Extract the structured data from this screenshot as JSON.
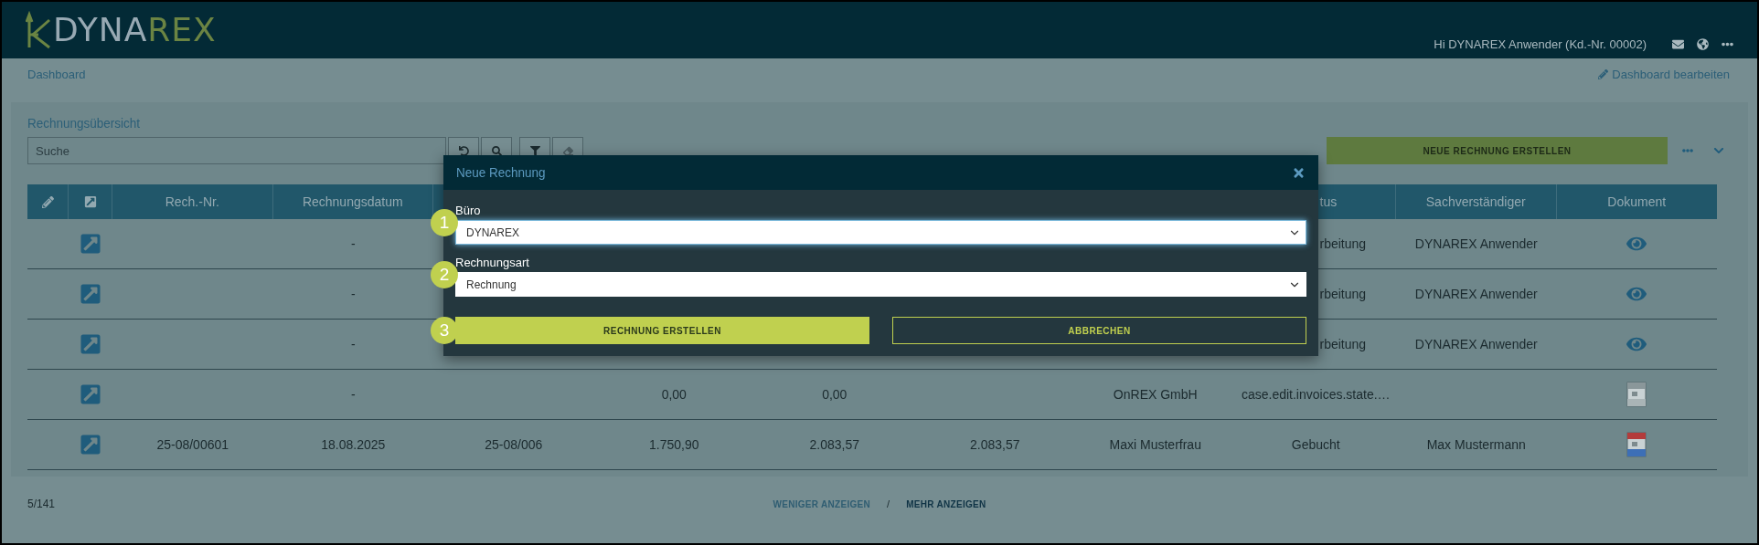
{
  "header": {
    "logo": {
      "part_1": "DYNA",
      "part_2": "REX"
    },
    "greeting": "Hi DYNAREX Anwender (Kd.-Nr. 00002)"
  },
  "breadcrumb": "Dashboard",
  "edit_dashboard_link": "Dashboard bearbeiten",
  "panel": {
    "title": "Rechnungsübersicht",
    "search": {
      "placeholder": "Suche"
    },
    "create_button": "NEUE RECHNUNG ERSTELLEN"
  },
  "table": {
    "columns": [
      {
        "kind": "edit"
      },
      {
        "kind": "link"
      },
      {
        "kind": "text",
        "label": "Rech.-Nr."
      },
      {
        "kind": "text",
        "label": "Rechnungsdatum"
      },
      {
        "kind": "covered"
      },
      {
        "kind": "covered"
      },
      {
        "kind": "covered"
      },
      {
        "kind": "covered"
      },
      {
        "kind": "covered"
      },
      {
        "kind": "partial",
        "label": "tus"
      },
      {
        "kind": "text",
        "label": "Sachverständiger"
      },
      {
        "kind": "text",
        "label": "Dokument"
      }
    ],
    "rows": [
      {
        "cells": [
          {
            "kind": "empty"
          },
          {
            "kind": "link"
          },
          {
            "kind": "empty"
          },
          {
            "kind": "text",
            "text": "-"
          },
          {
            "kind": "covered"
          },
          {
            "kind": "covered"
          },
          {
            "kind": "covered"
          },
          {
            "kind": "covered"
          },
          {
            "kind": "covered"
          },
          {
            "kind": "partial",
            "text": "rbeitung"
          },
          {
            "kind": "text",
            "text": "DYNAREX Anwender"
          },
          {
            "kind": "eye"
          }
        ]
      },
      {
        "cells": [
          {
            "kind": "empty"
          },
          {
            "kind": "link"
          },
          {
            "kind": "empty"
          },
          {
            "kind": "text",
            "text": "-"
          },
          {
            "kind": "covered"
          },
          {
            "kind": "covered"
          },
          {
            "kind": "covered"
          },
          {
            "kind": "covered"
          },
          {
            "kind": "covered"
          },
          {
            "kind": "partial",
            "text": "rbeitung"
          },
          {
            "kind": "text",
            "text": "DYNAREX Anwender"
          },
          {
            "kind": "eye"
          }
        ]
      },
      {
        "cells": [
          {
            "kind": "empty"
          },
          {
            "kind": "link"
          },
          {
            "kind": "empty"
          },
          {
            "kind": "text",
            "text": "-"
          },
          {
            "kind": "covered"
          },
          {
            "kind": "covered"
          },
          {
            "kind": "covered"
          },
          {
            "kind": "covered"
          },
          {
            "kind": "covered"
          },
          {
            "kind": "partial",
            "text": "rbeitung"
          },
          {
            "kind": "text",
            "text": "DYNAREX Anwender"
          },
          {
            "kind": "eye"
          }
        ]
      },
      {
        "cells": [
          {
            "kind": "empty"
          },
          {
            "kind": "link"
          },
          {
            "kind": "empty"
          },
          {
            "kind": "text",
            "text": "-"
          },
          {
            "kind": "empty"
          },
          {
            "kind": "text",
            "text": "0,00"
          },
          {
            "kind": "text",
            "text": "0,00"
          },
          {
            "kind": "empty"
          },
          {
            "kind": "text",
            "text": "OnREX GmbH"
          },
          {
            "kind": "text",
            "text": "case.edit.invoices.state.…"
          },
          {
            "kind": "empty"
          },
          {
            "kind": "file-gray"
          }
        ]
      },
      {
        "cells": [
          {
            "kind": "empty"
          },
          {
            "kind": "link"
          },
          {
            "kind": "text",
            "text": "25-08/00601"
          },
          {
            "kind": "text",
            "text": "18.08.2025"
          },
          {
            "kind": "text",
            "text": "25-08/006"
          },
          {
            "kind": "text",
            "text": "1.750,90"
          },
          {
            "kind": "text",
            "text": "2.083,57"
          },
          {
            "kind": "text",
            "text": "2.083,57"
          },
          {
            "kind": "text",
            "text": "Maxi Musterfrau"
          },
          {
            "kind": "text",
            "text": "Gebucht"
          },
          {
            "kind": "text",
            "text": "Max Mustermann"
          },
          {
            "kind": "file-color"
          }
        ]
      }
    ]
  },
  "footer": {
    "count": "5/141",
    "less": {
      "label": "WENIGER ANZEIGEN",
      "disabled": true
    },
    "separator": "/",
    "more": {
      "label": "MEHR ANZEIGEN",
      "disabled": false
    }
  },
  "modal": {
    "title": "Neue Rechnung",
    "fields": [
      {
        "step": "1",
        "label": "Büro",
        "value": "DYNAREX",
        "focused": true
      },
      {
        "step": "2",
        "label": "Rechnungsart",
        "value": "Rechnung",
        "focused": false
      }
    ],
    "step": "3",
    "buttons": [
      {
        "kind": "primary",
        "label": "RECHNUNG ERSTELLEN"
      },
      {
        "kind": "outline",
        "label": "ABBRECHEN"
      }
    ]
  }
}
